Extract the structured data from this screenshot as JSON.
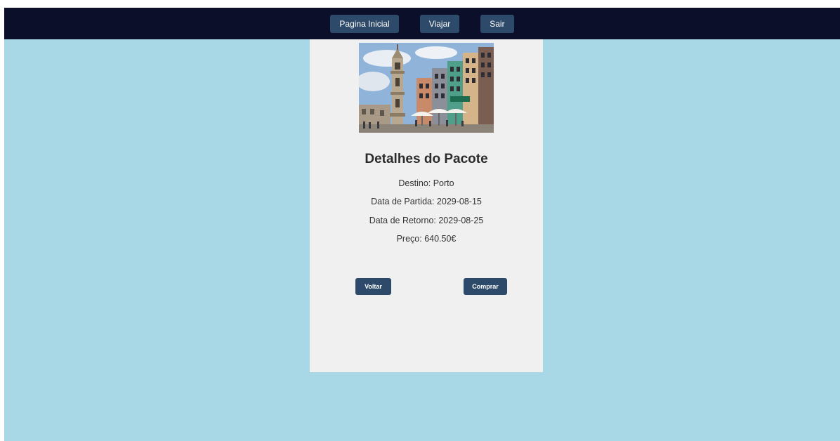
{
  "nav": {
    "home_label": "Pagina Inicial",
    "travel_label": "Viajar",
    "exit_label": "Sair"
  },
  "package": {
    "title": "Detalhes do Pacote",
    "destination": "Destino: Porto",
    "departure": "Data de Partida: 2029-08-15",
    "return": "Data de Retorno: 2029-08-25",
    "price": "Preço: 640.50€"
  },
  "actions": {
    "back_label": "Voltar",
    "buy_label": "Comprar"
  },
  "colors": {
    "navbar": "#0b0f2a",
    "button": "#2e4a6a",
    "background": "#a8d7e5",
    "card": "#f0f0f0"
  }
}
